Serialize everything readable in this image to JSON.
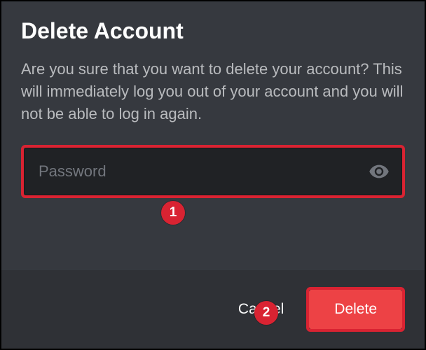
{
  "modal": {
    "title": "Delete Account",
    "description": "Are you sure that you want to delete your account? This will immediately log you out of your account and you will not be able to log in again.",
    "password_placeholder": "Password",
    "cancel_label": "Cancel",
    "delete_label": "Delete"
  },
  "annotations": {
    "badge_1": "1",
    "badge_2": "2"
  }
}
